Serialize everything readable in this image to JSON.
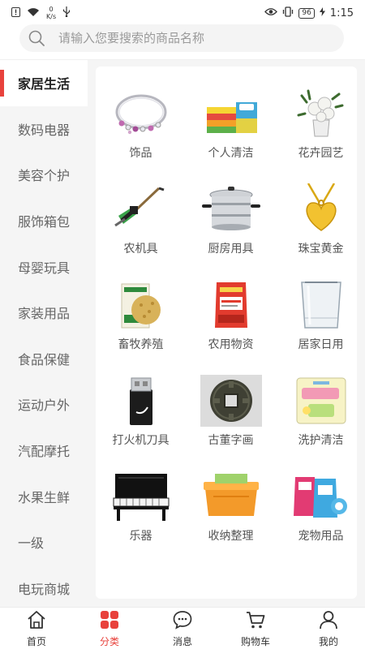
{
  "status_bar": {
    "speed_value": "0",
    "speed_unit": "K/s",
    "battery": "96",
    "time": "1:15"
  },
  "search": {
    "placeholder": "请输入您要搜索的商品名称",
    "icon": "search-icon"
  },
  "sidebar": {
    "active_index": 0,
    "items": [
      {
        "label": "家居生活"
      },
      {
        "label": "数码电器"
      },
      {
        "label": "美容个护"
      },
      {
        "label": "服饰箱包"
      },
      {
        "label": "母婴玩具"
      },
      {
        "label": "家装用品"
      },
      {
        "label": "食品保健"
      },
      {
        "label": "运动户外"
      },
      {
        "label": "汽配摩托"
      },
      {
        "label": "水果生鲜"
      },
      {
        "label": "一级"
      },
      {
        "label": "电玩商城"
      }
    ]
  },
  "categories": [
    {
      "label": "饰品",
      "icon": "bracelet-icon"
    },
    {
      "label": "个人清洁",
      "icon": "sponges-icon"
    },
    {
      "label": "花卉园艺",
      "icon": "flower-pot-icon"
    },
    {
      "label": "农机具",
      "icon": "hedge-trimmer-icon"
    },
    {
      "label": "厨房用具",
      "icon": "steamer-pot-icon"
    },
    {
      "label": "珠宝黄金",
      "icon": "gold-heart-pendant-icon"
    },
    {
      "label": "畜牧养殖",
      "icon": "feed-bag-icon"
    },
    {
      "label": "农用物资",
      "icon": "fertilizer-bag-icon"
    },
    {
      "label": "居家日用",
      "icon": "glass-vase-icon"
    },
    {
      "label": "打火机刀具",
      "icon": "lighter-icon"
    },
    {
      "label": "古董字画",
      "icon": "ancient-coin-icon"
    },
    {
      "label": "洗护清洁",
      "icon": "tissue-pack-icon"
    },
    {
      "label": "乐器",
      "icon": "piano-icon"
    },
    {
      "label": "收纳整理",
      "icon": "storage-box-icon"
    },
    {
      "label": "宠物用品",
      "icon": "pet-food-icon"
    }
  ],
  "tabbar": {
    "active_index": 1,
    "accent": "#e8423c",
    "items": [
      {
        "label": "首页",
        "icon": "home-icon"
      },
      {
        "label": "分类",
        "icon": "category-grid-icon"
      },
      {
        "label": "消息",
        "icon": "message-bubble-icon"
      },
      {
        "label": "购物车",
        "icon": "cart-icon"
      },
      {
        "label": "我的",
        "icon": "user-icon"
      }
    ]
  }
}
